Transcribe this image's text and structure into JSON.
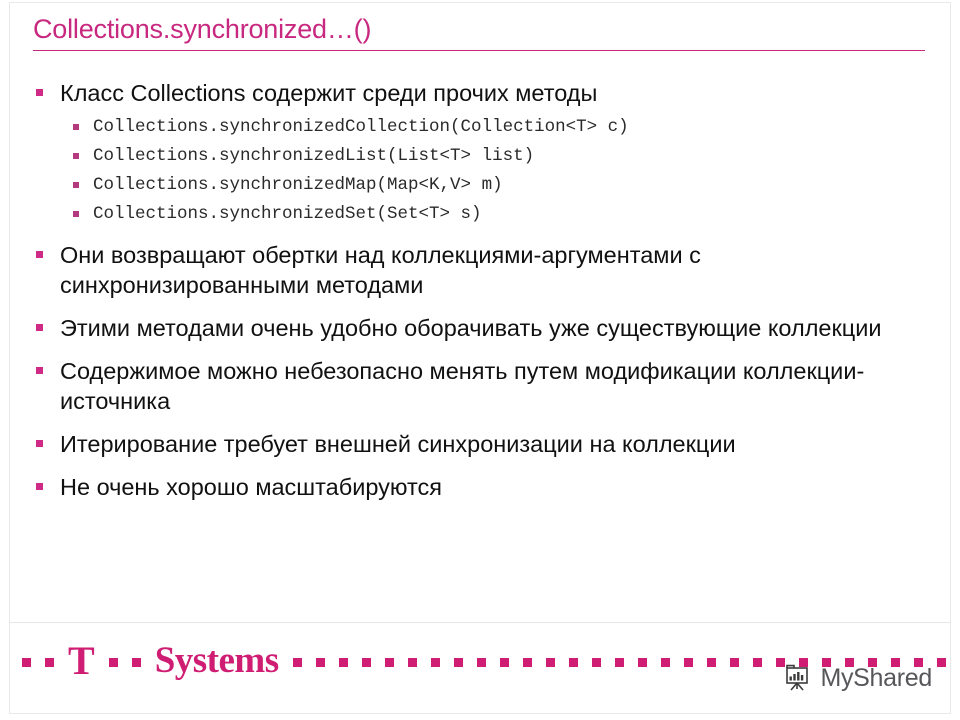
{
  "slide": {
    "title": "Collections.synchronized…()",
    "accent_color": "#c8287f",
    "bullet_color": "#cf2b86",
    "text_color": "#111111"
  },
  "content": {
    "items": [
      {
        "text": "Класс Collections содержит среди прочих методы",
        "code_lines": [
          "Collections.synchronizedCollection(Collection<T> c)",
          "Collections.synchronizedList(List<T> list)",
          "Collections.synchronizedMap(Map<K,V> m)",
          "Collections.synchronizedSet(Set<T> s)"
        ]
      },
      {
        "text": "Они возвращают обертки над коллекциями-аргументами с синхронизированными методами",
        "code_lines": []
      },
      {
        "text": "Этими методами очень удобно оборачивать уже существующие коллекции",
        "code_lines": []
      },
      {
        "text": "Содержимое можно небезопасно менять путем модификации коллекции-источника",
        "code_lines": []
      },
      {
        "text": "Итерирование требует внешней синхронизации на коллекции",
        "code_lines": []
      },
      {
        "text": "Не очень хорошо масштабируются",
        "code_lines": []
      }
    ]
  },
  "footer": {
    "logo_t": "T",
    "logo_word": "Systems",
    "logo_color": "#cf1d73",
    "dot_count_left": 2,
    "dot_count_mid": 2,
    "dot_count_right": 30,
    "watermark_label": "MyShared",
    "watermark_icon": "presentation-board-icon"
  }
}
